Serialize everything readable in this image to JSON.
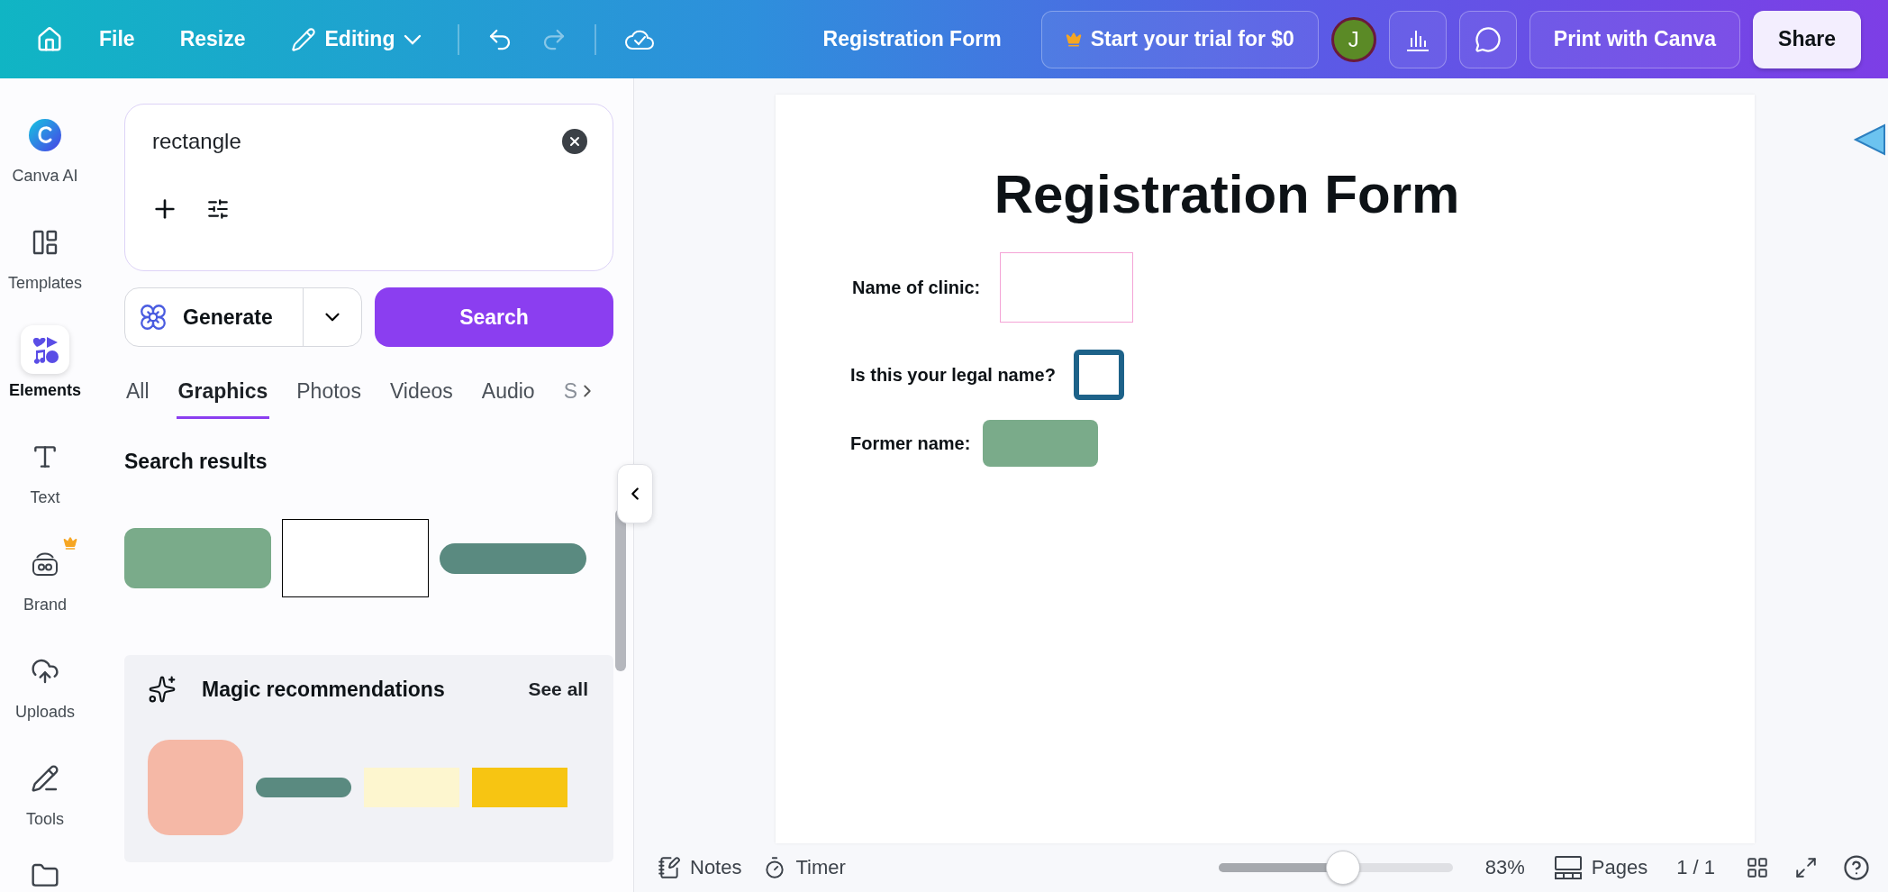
{
  "topbar": {
    "menu": [
      {
        "label": "File"
      },
      {
        "label": "Resize"
      }
    ],
    "mode": "Editing",
    "title": "Registration Form",
    "trial": "Start your trial for $0",
    "avatar": "J",
    "print": "Print with Canva",
    "share": "Share"
  },
  "rail": [
    {
      "label": "Canva AI",
      "selected": false,
      "premium": false
    },
    {
      "label": "Templates",
      "selected": false,
      "premium": false
    },
    {
      "label": "Elements",
      "selected": true,
      "premium": false
    },
    {
      "label": "Text",
      "selected": false,
      "premium": false
    },
    {
      "label": "Brand",
      "selected": false,
      "premium": true
    },
    {
      "label": "Uploads",
      "selected": false,
      "premium": false
    },
    {
      "label": "Tools",
      "selected": false,
      "premium": false
    }
  ],
  "panel": {
    "search": {
      "value": "rectangle"
    },
    "generate": "Generate",
    "search_button": "Search",
    "tabs": [
      {
        "label": "All",
        "selected": false
      },
      {
        "label": "Graphics",
        "selected": true
      },
      {
        "label": "Photos",
        "selected": false
      },
      {
        "label": "Videos",
        "selected": false
      },
      {
        "label": "Audio",
        "selected": false
      },
      {
        "label": "S",
        "selected": false
      }
    ],
    "results_title": "Search results",
    "results": [
      {
        "kind": "rounded",
        "color": "#7aab8a"
      },
      {
        "kind": "outline",
        "color": "#000000"
      },
      {
        "kind": "pill",
        "color": "#5a8a80"
      }
    ],
    "magic": {
      "title": "Magic recommendations",
      "see_all": "See all",
      "items": [
        {
          "kind": "square",
          "color": "#f5b8a6"
        },
        {
          "kind": "pill",
          "color": "#5a8a80"
        },
        {
          "kind": "bar",
          "color": "#fdf6cf"
        },
        {
          "kind": "bar",
          "color": "#f7c512"
        }
      ]
    }
  },
  "document": {
    "title": "Registration Form",
    "fields": [
      {
        "label": "Name of clinic:",
        "kind": "box"
      },
      {
        "label": "Is this your legal name?",
        "kind": "checkbox"
      },
      {
        "label": "Former name:",
        "kind": "filled"
      }
    ]
  },
  "footer": {
    "notes": "Notes",
    "timer": "Timer",
    "zoom": {
      "level": 0.53,
      "reading": "83%"
    },
    "pages": "Pages",
    "page_count": "1 / 1"
  }
}
